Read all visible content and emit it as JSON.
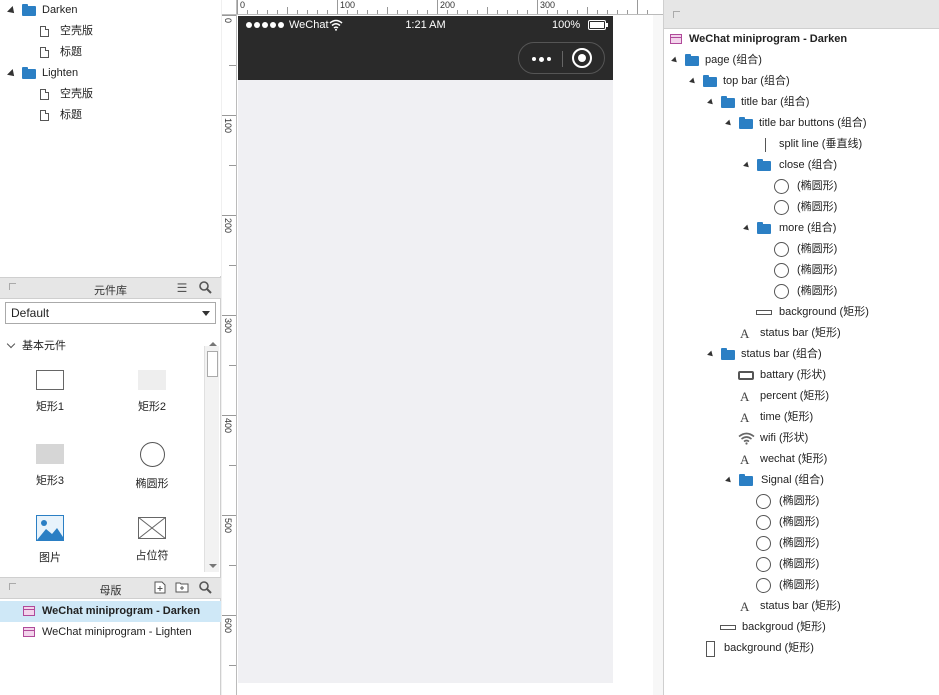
{
  "pages": [
    {
      "label": "Darken",
      "type": "folder"
    },
    {
      "label": "空壳版",
      "type": "page"
    },
    {
      "label": "标题",
      "type": "page"
    },
    {
      "label": "Lighten",
      "type": "folder"
    },
    {
      "label": "空壳版",
      "type": "page"
    },
    {
      "label": "标题",
      "type": "page"
    }
  ],
  "library": {
    "title": "元件库",
    "selected": "Default",
    "section": "基本元件",
    "widgets": [
      "矩形1",
      "矩形2",
      "矩形3",
      "椭圆形",
      "图片",
      "占位符"
    ]
  },
  "masters": {
    "title": "母版",
    "items": [
      "WeChat miniprogram - Darken",
      "WeChat miniprogram - Lighten"
    ]
  },
  "ruler": {
    "h_labels": [
      "0",
      "100",
      "200",
      "300"
    ],
    "v_labels": [
      "0",
      "100",
      "200",
      "300",
      "400",
      "500",
      "600"
    ]
  },
  "phone": {
    "carrier": "WeChat",
    "time": "1:21 AM",
    "battery_percent": "100%",
    "top_bg": "#2a2a2a",
    "body_bg": "#f0f0f3"
  },
  "outline": {
    "root": "WeChat miniprogram - Darken",
    "items": [
      "page (组合)",
      "top bar (组合)",
      "title bar (组合)",
      "title bar buttons (组合)",
      "split line (垂直线)",
      "close (组合)",
      "(椭圆形)",
      "(椭圆形)",
      "more (组合)",
      "(椭圆形)",
      "(椭圆形)",
      "(椭圆形)",
      "background (矩形)",
      "status bar (矩形)",
      "status bar (组合)",
      "battary (形状)",
      "percent (矩形)",
      "time (矩形)",
      "wifi (形状)",
      "wechat (矩形)",
      "Signal (组合)",
      "(椭圆形)",
      "(椭圆形)",
      "(椭圆形)",
      "(椭圆形)",
      "(椭圆形)",
      "status bar (矩形)",
      "backgroud (矩形)",
      "background (矩形)"
    ]
  },
  "colors": {
    "accent_blue": "#2b7fc4",
    "selection": "#cfe8f7",
    "master_pink": "#b04a9a"
  }
}
